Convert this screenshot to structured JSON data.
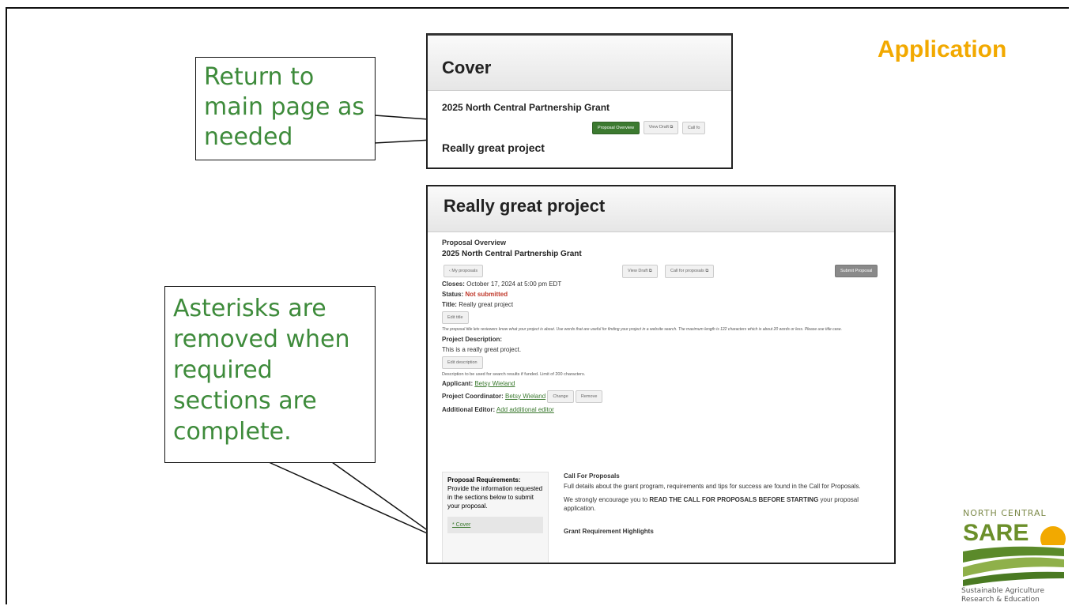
{
  "slide": {
    "title": "Application"
  },
  "callouts": {
    "return_main": [
      "Return to",
      "main page as",
      "needed"
    ],
    "asterisks": [
      "Asterisks are",
      "removed when",
      "required",
      "sections are",
      "complete."
    ]
  },
  "cover_panel": {
    "header": "Cover",
    "grant_name": "2025 North Central Partnership Grant",
    "buttons": {
      "overview": "Proposal Overview",
      "view_draft": "View Draft",
      "call_for": "Call fo"
    },
    "project_title": "Really great project"
  },
  "main_panel": {
    "header": "Really great project",
    "subheading": "Proposal Overview",
    "grant_name": "2025 North Central Partnership Grant",
    "buttons": {
      "my_proposals": "‹ My proposals",
      "view_draft": "View Draft",
      "call_for_proposals": "Call for proposals",
      "submit": "Submit Proposal",
      "edit_title": "Edit title",
      "edit_description": "Edit description",
      "change": "Change",
      "remove": "Remove"
    },
    "closes_label": "Closes:",
    "closes_value": "October 17, 2024 at 5:00 pm EDT",
    "status_label": "Status:",
    "status_value": "Not submitted",
    "title_label": "Title:",
    "title_value": "Really great project",
    "title_help": "The proposal title lets reviewers know what your project is about. Use words that are useful for finding your project in a website search. The maximum length is 122 characters which is about 20 words or less. Please use title case.",
    "description_label": "Project Description:",
    "description_value": "This is a really great project.",
    "description_help": "Description to be used for search results if funded. Limit of 200 characters.",
    "applicant_label": "Applicant:",
    "applicant_value": "Betsy Wieland",
    "coordinator_label": "Project Coordinator:",
    "coordinator_value": "Betsy Wieland",
    "editor_label": "Additional Editor:",
    "editor_value": "Add additional editor",
    "requirements": {
      "heading": "Proposal Requirements:",
      "text": "Provide the information requested in the sections below to submit your proposal.",
      "cover_item": "* Cover"
    },
    "cfp": {
      "heading": "Call For Proposals",
      "text": "Full details about the grant program, requirements and tips for success are found in the Call for Proposals.",
      "encourage_prefix": "We strongly encourage you to ",
      "encourage_bold": "READ THE CALL FOR PROPOSALS BEFORE STARTING",
      "encourage_suffix": " your proposal application.",
      "highlights": "Grant Requirement Highlights"
    }
  },
  "logo": {
    "top": "NORTH CENTRAL",
    "brand": "SARE",
    "line1": "Sustainable Agriculture",
    "line2": "Research & Education"
  },
  "colors": {
    "accent": "#f2a900",
    "callout_text": "#3e8b3b",
    "button_green": "#3c7a30",
    "status_red": "#c0392b"
  }
}
